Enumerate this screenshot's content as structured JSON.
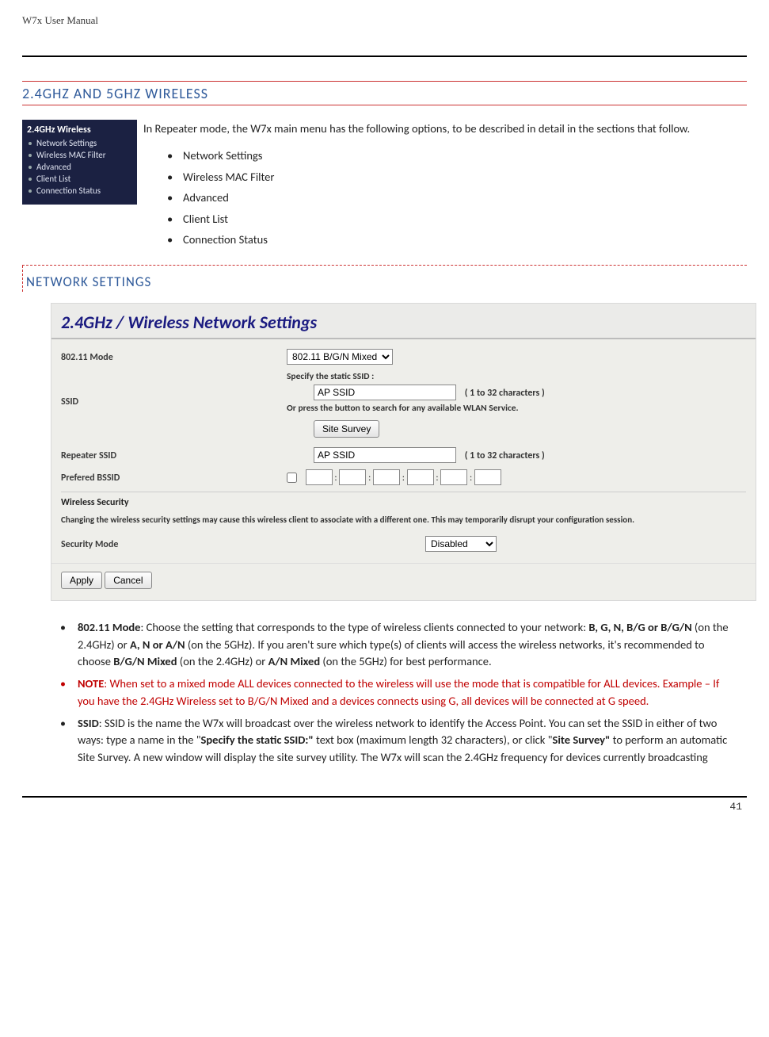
{
  "header": {
    "title": "W7x  User Manual"
  },
  "section_title": "2.4GHZ AND 5GHZ WIRELESS",
  "side_menu": {
    "heading": "2.4GHz Wireless",
    "items": [
      {
        "label": "Network Settings"
      },
      {
        "label": "Wireless MAC Filter"
      },
      {
        "label": "Advanced"
      },
      {
        "label": "Client List"
      },
      {
        "label": "Connection Status"
      }
    ]
  },
  "intro": {
    "paragraph": "In Repeater mode, the W7x main menu has the following options, to be described in detail in the sections that follow.",
    "items": [
      {
        "label": "Network Settings"
      },
      {
        "label": "Wireless MAC Filter"
      },
      {
        "label": "Advanced"
      },
      {
        "label": "Client List"
      },
      {
        "label": "Connection Status"
      }
    ]
  },
  "subsection_title": "NETWORK SETTINGS",
  "panel": {
    "title": "2.4GHz / Wireless Network Settings",
    "mode_label": "802.11 Mode",
    "mode_value": "802.11 B/G/N Mixed",
    "ssid_label": "SSID",
    "ssid_hint1": "Specify the static SSID  :",
    "ssid_value": "AP SSID",
    "ssid_chars": "( 1 to 32 characters )",
    "ssid_hint2": "Or press the button to search for any available WLAN Service.",
    "site_survey_btn": "Site Survey",
    "repeater_label": "Repeater SSID",
    "repeater_value": "AP SSID",
    "repeater_chars": "( 1 to 32 characters )",
    "bssid_label": "Prefered BSSID",
    "sec_heading": "Wireless Security",
    "sec_warn": "Changing the wireless security settings may cause this wireless client to associate with a different one. This may temporarily disrupt your configuration session.",
    "secmode_label": "Security Mode",
    "secmode_value": "Disabled",
    "apply_btn": "Apply",
    "cancel_btn": "Cancel"
  },
  "bullets": {
    "b1_label": "802.11 Mode",
    "b1_rest": ": Choose the setting that corresponds to the type of wireless clients connected to your network: ",
    "b1_bold1": "B, G, N, B/G or B/G/N",
    "b1_mid1": " (on the 2.4GHz) or ",
    "b1_bold2": "A, N or A/N",
    "b1_mid2": " (on the 5GHz).   If you aren't sure which type(s) of clients will access the wireless networks, it's recommended to choose ",
    "b1_bold3": "B/G/N Mixed",
    "b1_mid3": " (on the 2.4GHz) or ",
    "b1_bold4": "A/N Mixed",
    "b1_tail": " (on the 5GHz) for best performance.",
    "b2_label": "NOTE",
    "b2_text": ": When set to a mixed mode ALL devices connected to the wireless will use the mode that is compatible for ALL devices.  Example – If you have the 2.4GHz Wireless set to B/G/N Mixed and a devices connects using G, all devices will be connected at G speed.",
    "b3_label": "SSID",
    "b3_t1": ": SSID is the name the W7x will broadcast over the wireless network to identify the Access Point. You can set the SSID in either of two ways: type a name in the \"",
    "b3_b1": "Specify the static SSID:\"",
    "b3_t2": " text box (maximum length 32 characters), or click \"",
    "b3_b2": "Site Survey\"",
    "b3_t3": " to perform an automatic Site Survey. A new window will display the site survey utility. The W7x will scan the 2.4GHz frequency for devices currently broadcasting"
  },
  "page_number": "41"
}
